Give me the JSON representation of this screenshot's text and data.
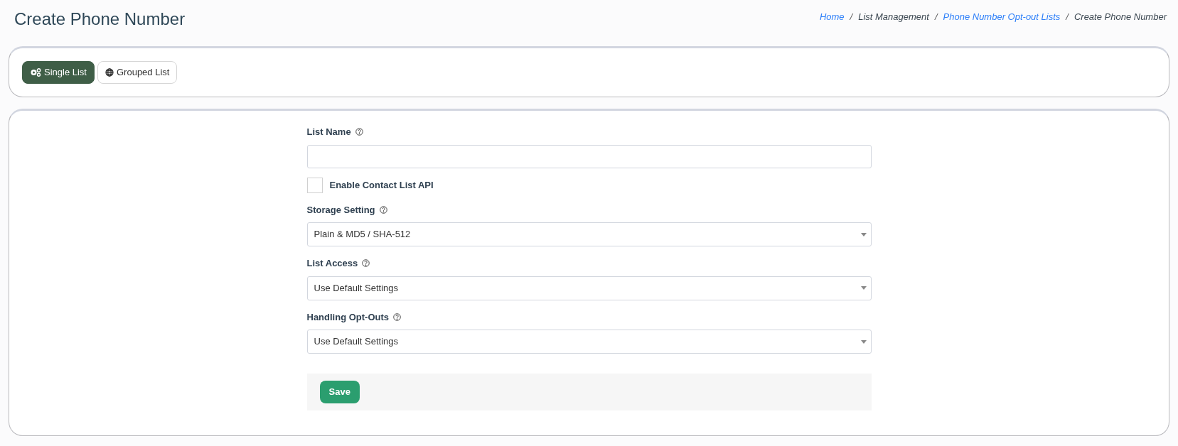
{
  "page_title": "Create Phone Number",
  "breadcrumb_separator": "/",
  "breadcrumb": [
    {
      "label": "Home",
      "link": true
    },
    {
      "label": "List Management",
      "link": false
    },
    {
      "label": "Phone Number Opt-out Lists",
      "link": true
    },
    {
      "label": "Create Phone Number",
      "link": false
    }
  ],
  "tabs": [
    {
      "label": "Single List",
      "selected": true
    },
    {
      "label": "Grouped List",
      "selected": false
    }
  ],
  "form": [
    {
      "kind": "text",
      "label": "List Name",
      "help": true
    },
    {
      "kind": "checkbox",
      "label": "Enable Contact List API",
      "checked": false
    },
    {
      "kind": "select",
      "label": "Storage Setting",
      "help": true,
      "value": "Plain & MD5 / SHA-512"
    },
    {
      "kind": "select",
      "label": "List Access",
      "help": true,
      "value": "Use Default Settings"
    },
    {
      "kind": "select",
      "label": "Handling Opt-Outs",
      "help": true,
      "value": "Use Default Settings"
    }
  ],
  "save_button": "Save"
}
